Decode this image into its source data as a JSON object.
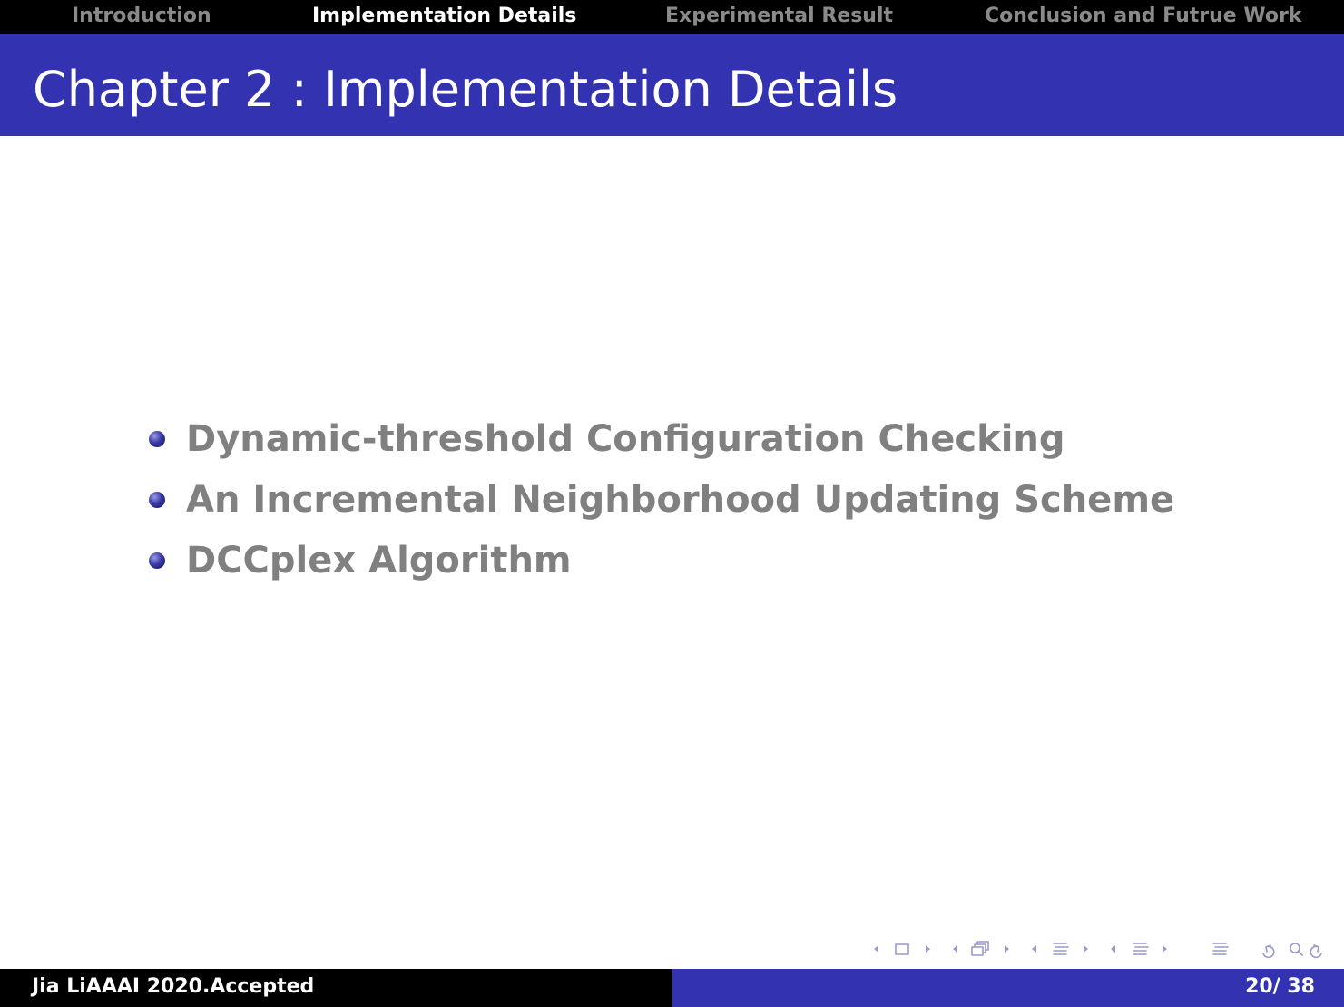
{
  "nav": {
    "sections": [
      {
        "label": "Introduction",
        "active": false
      },
      {
        "label": "Implementation Details",
        "active": true
      },
      {
        "label": "Experimental Result",
        "active": false
      },
      {
        "label": "Conclusion and Futrue Work",
        "active": false
      }
    ]
  },
  "frame": {
    "title": "Chapter 2 : Implementation Details"
  },
  "content": {
    "items": [
      "Dynamic-threshold Configuration Checking",
      "An Incremental Neighborhood Updating Scheme",
      "DCCplex Algorithm"
    ]
  },
  "footer": {
    "author": "Jia LiAAAI 2020.Accepted",
    "page": "20/ 38"
  },
  "navigation_symbols": [
    "frame-nav-icon",
    "subsection-nav-icon",
    "section-nav-icon",
    "appendix-nav-icon",
    "align-icon",
    "back-icon",
    "search-icon",
    "forward-icon"
  ],
  "colors": {
    "nav_bar": "#000000",
    "title_bar": "#3333b2",
    "active_nav": "#ffffff",
    "inactive_nav": "#8a8a8a",
    "body_text": "#808080",
    "footer_left": "#000000",
    "footer_right": "#3333b2"
  }
}
